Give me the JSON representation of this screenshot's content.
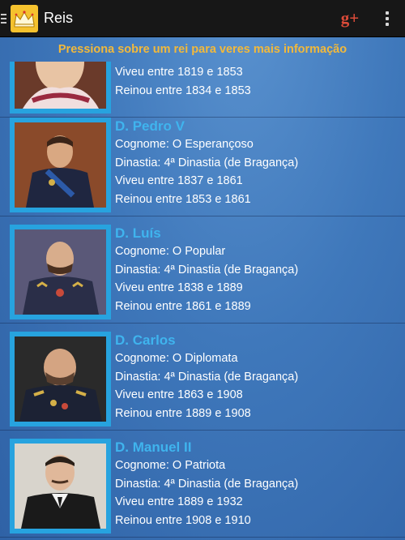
{
  "action_bar": {
    "title": "Reis",
    "app_icon": "crown-icon",
    "share_icon": "google-plus-icon",
    "overflow_icon": "overflow-menu-icon",
    "gplus_label": "g+"
  },
  "hint": "Pressiona sobre um rei para veres mais informação",
  "kings": [
    {
      "name": "",
      "cognome": "",
      "dinastia": "",
      "viveu": "Viveu entre 1819 e 1853",
      "reinou": "Reinou entre 1834 e 1853"
    },
    {
      "name": "D. Pedro V",
      "cognome": "Cognome: O Esperançoso",
      "dinastia": "Dinastia: 4ª Dinastia (de Bragança)",
      "viveu": "Viveu entre 1837 e 1861",
      "reinou": "Reinou entre 1853 e 1861"
    },
    {
      "name": "D. Luís",
      "cognome": "Cognome: O Popular",
      "dinastia": "Dinastia: 4ª Dinastia (de Bragança)",
      "viveu": "Viveu entre 1838 e 1889",
      "reinou": "Reinou entre 1861 e 1889"
    },
    {
      "name": "D. Carlos",
      "cognome": "Cognome: O Diplomata",
      "dinastia": "Dinastia: 4ª Dinastia (de Bragança)",
      "viveu": "Viveu entre 1863 e 1908",
      "reinou": "Reinou entre 1889 e 1908"
    },
    {
      "name": "D. Manuel II",
      "cognome": "Cognome: O Patriota",
      "dinastia": "Dinastia: 4ª Dinastia (de Bragança)",
      "viveu": "Viveu entre 1889 e 1932",
      "reinou": "Reinou entre 1908 e 1910"
    }
  ],
  "colors": {
    "action_bar": "#171717",
    "accent_gold": "#f2b93b",
    "name_blue": "#3fb4ee",
    "frame_blue": "#27a3df",
    "gplus_red": "#dd4b39"
  }
}
